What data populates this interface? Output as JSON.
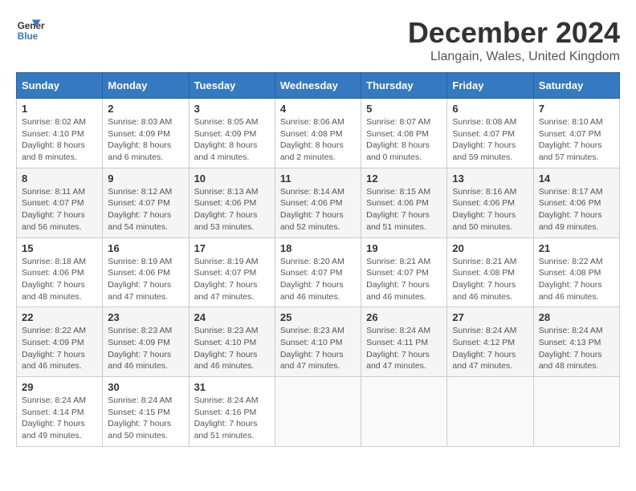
{
  "header": {
    "logo_line1": "General",
    "logo_line2": "Blue",
    "title": "December 2024",
    "subtitle": "Llangain, Wales, United Kingdom"
  },
  "calendar": {
    "days_of_week": [
      "Sunday",
      "Monday",
      "Tuesday",
      "Wednesday",
      "Thursday",
      "Friday",
      "Saturday"
    ],
    "weeks": [
      [
        {
          "day": "1",
          "info": "Sunrise: 8:02 AM\nSunset: 4:10 PM\nDaylight: 8 hours and 8 minutes."
        },
        {
          "day": "2",
          "info": "Sunrise: 8:03 AM\nSunset: 4:09 PM\nDaylight: 8 hours and 6 minutes."
        },
        {
          "day": "3",
          "info": "Sunrise: 8:05 AM\nSunset: 4:09 PM\nDaylight: 8 hours and 4 minutes."
        },
        {
          "day": "4",
          "info": "Sunrise: 8:06 AM\nSunset: 4:08 PM\nDaylight: 8 hours and 2 minutes."
        },
        {
          "day": "5",
          "info": "Sunrise: 8:07 AM\nSunset: 4:08 PM\nDaylight: 8 hours and 0 minutes."
        },
        {
          "day": "6",
          "info": "Sunrise: 8:08 AM\nSunset: 4:07 PM\nDaylight: 7 hours and 59 minutes."
        },
        {
          "day": "7",
          "info": "Sunrise: 8:10 AM\nSunset: 4:07 PM\nDaylight: 7 hours and 57 minutes."
        }
      ],
      [
        {
          "day": "8",
          "info": "Sunrise: 8:11 AM\nSunset: 4:07 PM\nDaylight: 7 hours and 56 minutes."
        },
        {
          "day": "9",
          "info": "Sunrise: 8:12 AM\nSunset: 4:07 PM\nDaylight: 7 hours and 54 minutes."
        },
        {
          "day": "10",
          "info": "Sunrise: 8:13 AM\nSunset: 4:06 PM\nDaylight: 7 hours and 53 minutes."
        },
        {
          "day": "11",
          "info": "Sunrise: 8:14 AM\nSunset: 4:06 PM\nDaylight: 7 hours and 52 minutes."
        },
        {
          "day": "12",
          "info": "Sunrise: 8:15 AM\nSunset: 4:06 PM\nDaylight: 7 hours and 51 minutes."
        },
        {
          "day": "13",
          "info": "Sunrise: 8:16 AM\nSunset: 4:06 PM\nDaylight: 7 hours and 50 minutes."
        },
        {
          "day": "14",
          "info": "Sunrise: 8:17 AM\nSunset: 4:06 PM\nDaylight: 7 hours and 49 minutes."
        }
      ],
      [
        {
          "day": "15",
          "info": "Sunrise: 8:18 AM\nSunset: 4:06 PM\nDaylight: 7 hours and 48 minutes."
        },
        {
          "day": "16",
          "info": "Sunrise: 8:19 AM\nSunset: 4:06 PM\nDaylight: 7 hours and 47 minutes."
        },
        {
          "day": "17",
          "info": "Sunrise: 8:19 AM\nSunset: 4:07 PM\nDaylight: 7 hours and 47 minutes."
        },
        {
          "day": "18",
          "info": "Sunrise: 8:20 AM\nSunset: 4:07 PM\nDaylight: 7 hours and 46 minutes."
        },
        {
          "day": "19",
          "info": "Sunrise: 8:21 AM\nSunset: 4:07 PM\nDaylight: 7 hours and 46 minutes."
        },
        {
          "day": "20",
          "info": "Sunrise: 8:21 AM\nSunset: 4:08 PM\nDaylight: 7 hours and 46 minutes."
        },
        {
          "day": "21",
          "info": "Sunrise: 8:22 AM\nSunset: 4:08 PM\nDaylight: 7 hours and 46 minutes."
        }
      ],
      [
        {
          "day": "22",
          "info": "Sunrise: 8:22 AM\nSunset: 4:09 PM\nDaylight: 7 hours and 46 minutes."
        },
        {
          "day": "23",
          "info": "Sunrise: 8:23 AM\nSunset: 4:09 PM\nDaylight: 7 hours and 46 minutes."
        },
        {
          "day": "24",
          "info": "Sunrise: 8:23 AM\nSunset: 4:10 PM\nDaylight: 7 hours and 46 minutes."
        },
        {
          "day": "25",
          "info": "Sunrise: 8:23 AM\nSunset: 4:10 PM\nDaylight: 7 hours and 47 minutes."
        },
        {
          "day": "26",
          "info": "Sunrise: 8:24 AM\nSunset: 4:11 PM\nDaylight: 7 hours and 47 minutes."
        },
        {
          "day": "27",
          "info": "Sunrise: 8:24 AM\nSunset: 4:12 PM\nDaylight: 7 hours and 47 minutes."
        },
        {
          "day": "28",
          "info": "Sunrise: 8:24 AM\nSunset: 4:13 PM\nDaylight: 7 hours and 48 minutes."
        }
      ],
      [
        {
          "day": "29",
          "info": "Sunrise: 8:24 AM\nSunset: 4:14 PM\nDaylight: 7 hours and 49 minutes."
        },
        {
          "day": "30",
          "info": "Sunrise: 8:24 AM\nSunset: 4:15 PM\nDaylight: 7 hours and 50 minutes."
        },
        {
          "day": "31",
          "info": "Sunrise: 8:24 AM\nSunset: 4:16 PM\nDaylight: 7 hours and 51 minutes."
        },
        null,
        null,
        null,
        null
      ]
    ]
  }
}
